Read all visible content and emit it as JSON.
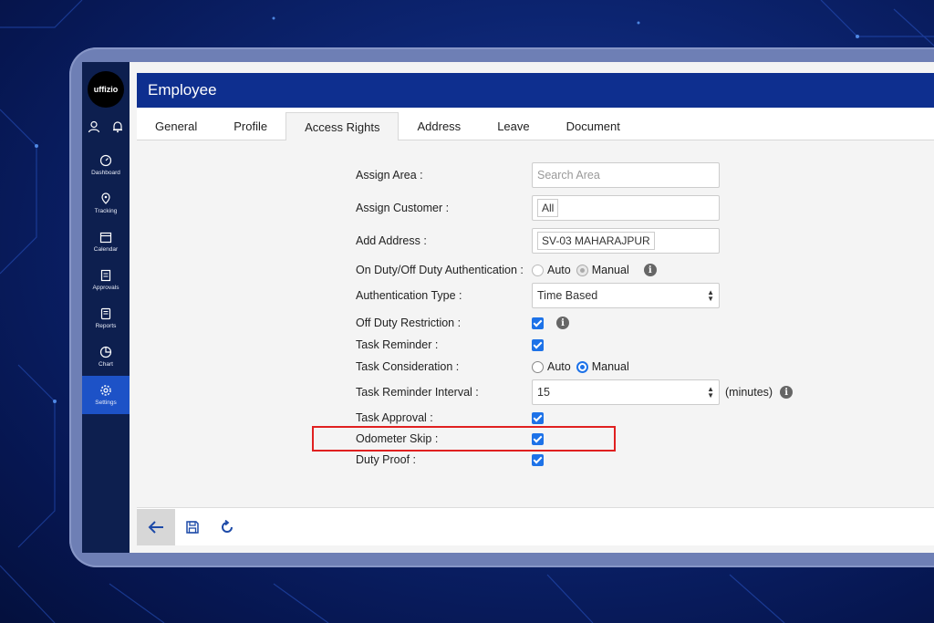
{
  "app": {
    "logo_text": "uffizio"
  },
  "sidebar": {
    "items": [
      {
        "label": "Dashboard",
        "icon": "dashboard-icon"
      },
      {
        "label": "Tracking",
        "icon": "tracking-icon"
      },
      {
        "label": "Calendar",
        "icon": "calendar-icon"
      },
      {
        "label": "Approvals",
        "icon": "approvals-icon"
      },
      {
        "label": "Reports",
        "icon": "reports-icon"
      },
      {
        "label": "Chart",
        "icon": "chart-icon"
      },
      {
        "label": "Settings",
        "icon": "settings-icon",
        "active": true
      }
    ]
  },
  "header": {
    "title": "Employee"
  },
  "tabs": [
    "General",
    "Profile",
    "Access Rights",
    "Address",
    "Leave",
    "Document"
  ],
  "active_tab": "Access Rights",
  "form": {
    "assign_area": {
      "label": "Assign Area :",
      "placeholder": "Search Area"
    },
    "assign_customer": {
      "label": "Assign Customer :",
      "value": "All"
    },
    "add_address": {
      "label": "Add Address :",
      "value": "SV-03 MAHARAJPUR"
    },
    "on_duty_auth": {
      "label": "On Duty/Off Duty Authentication :",
      "option_auto": "Auto",
      "option_manual": "Manual",
      "selected": "Manual"
    },
    "auth_type": {
      "label": "Authentication Type :",
      "value": "Time Based"
    },
    "off_duty_restriction": {
      "label": "Off Duty Restriction :",
      "checked": true
    },
    "task_reminder": {
      "label": "Task Reminder :",
      "checked": true
    },
    "task_consideration": {
      "label": "Task Consideration :",
      "option_auto": "Auto",
      "option_manual": "Manual",
      "selected": "Manual"
    },
    "task_reminder_interval": {
      "label": "Task Reminder Interval :",
      "value": "15",
      "unit": "(minutes)"
    },
    "task_approval": {
      "label": "Task Approval :",
      "checked": true
    },
    "odometer_skip": {
      "label": "Odometer Skip :",
      "checked": true
    },
    "duty_proof": {
      "label": "Duty Proof :",
      "checked": true
    }
  },
  "colors": {
    "header": "#0e2f8f",
    "sidebar": "#0d1f4f",
    "accent": "#1d72e8",
    "highlight": "#e02020"
  }
}
